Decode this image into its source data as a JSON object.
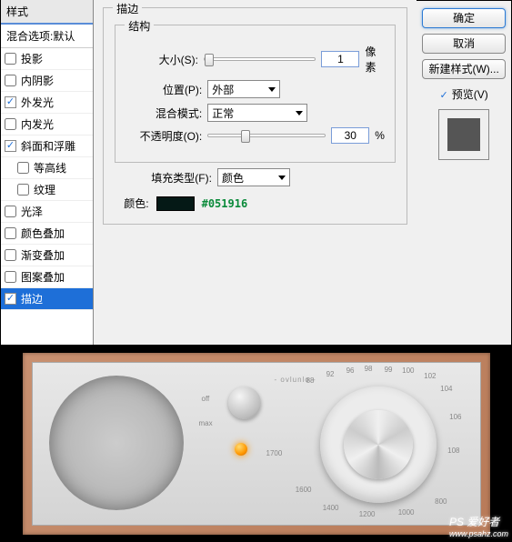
{
  "styles_panel": {
    "header": "样式",
    "blend_default": "混合选项:默认",
    "items": [
      {
        "label": "投影",
        "checked": false,
        "indent": false
      },
      {
        "label": "内阴影",
        "checked": false,
        "indent": false
      },
      {
        "label": "外发光",
        "checked": true,
        "indent": false
      },
      {
        "label": "内发光",
        "checked": false,
        "indent": false
      },
      {
        "label": "斜面和浮雕",
        "checked": true,
        "indent": false
      },
      {
        "label": "等高线",
        "checked": false,
        "indent": true
      },
      {
        "label": "纹理",
        "checked": false,
        "indent": true
      },
      {
        "label": "光泽",
        "checked": false,
        "indent": false
      },
      {
        "label": "颜色叠加",
        "checked": false,
        "indent": false
      },
      {
        "label": "渐变叠加",
        "checked": false,
        "indent": false
      },
      {
        "label": "图案叠加",
        "checked": false,
        "indent": false
      },
      {
        "label": "描边",
        "checked": true,
        "indent": false,
        "selected": true
      }
    ]
  },
  "stroke": {
    "title": "描边",
    "structure_title": "结构",
    "size_label": "大小(S):",
    "size_value": "1",
    "size_unit": "像素",
    "position_label": "位置(P):",
    "position_value": "外部",
    "blend_label": "混合模式:",
    "blend_value": "正常",
    "opacity_label": "不透明度(O):",
    "opacity_value": "30",
    "opacity_unit": "%",
    "fill_type_label": "填充类型(F):",
    "fill_type_value": "颜色",
    "color_label": "颜色:",
    "color_hex": "#051916"
  },
  "buttons": {
    "ok": "确定",
    "cancel": "取消",
    "new_style": "新建样式(W)...",
    "preview": "预览(V)"
  },
  "radio": {
    "brand": "- ovlunlo -",
    "off": "off",
    "max": "max",
    "s1700": "1700",
    "freqs": [
      "88",
      "92",
      "96",
      "98",
      "99",
      "100",
      "102",
      "104",
      "106",
      "108",
      "800",
      "1000",
      "1200",
      "1400",
      "1600"
    ]
  },
  "watermark": {
    "main": "PS 爱好者",
    "sub": "www.psahz.com"
  }
}
